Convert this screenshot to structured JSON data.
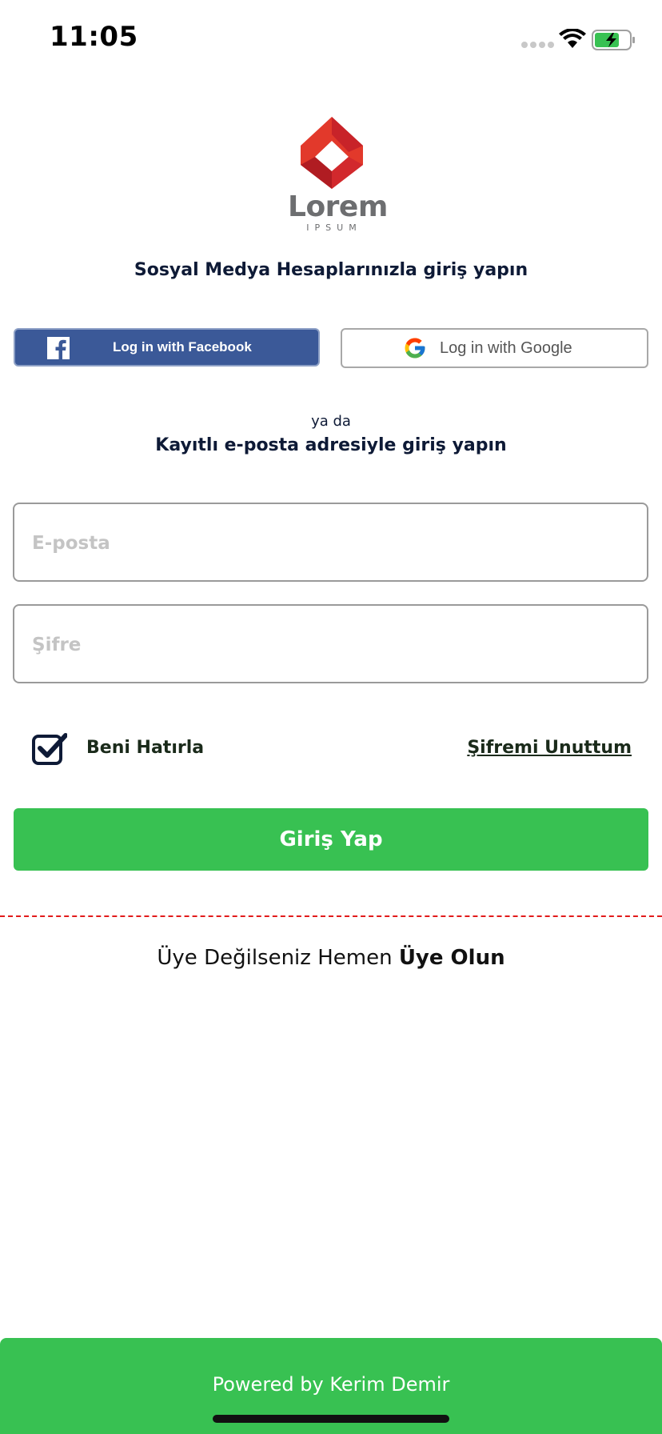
{
  "status_bar": {
    "time": "11:05"
  },
  "logo": {
    "word": "Lorem",
    "sub": "IPSUM",
    "colors": {
      "primary": "#e2392b",
      "dark": "#b01c22"
    }
  },
  "social": {
    "title": "Sosyal Medya Hesaplarınızla giriş yapın",
    "facebook_label": "Log in with Facebook",
    "google_label": "Log in with Google"
  },
  "separator": {
    "or_text": "ya da",
    "email_title": "Kayıtlı e-posta adresiyle giriş yapın"
  },
  "form": {
    "email_placeholder": "E-posta",
    "email_value": "",
    "password_placeholder": "Şifre",
    "password_value": "",
    "remember_label": "Beni Hatırla",
    "remember_checked": true,
    "forgot_label": "Şifremi Unuttum",
    "submit_label": "Giriş Yap"
  },
  "signup": {
    "prefix": "Üye Değilseniz Hemen ",
    "link": "Üye Olun"
  },
  "footer": {
    "text": "Powered by Kerim Demir"
  },
  "colors": {
    "accent_green": "#38c152",
    "facebook_blue": "#3b5998",
    "divider_red": "#e21b1b",
    "heading_navy": "#0e1a36"
  }
}
